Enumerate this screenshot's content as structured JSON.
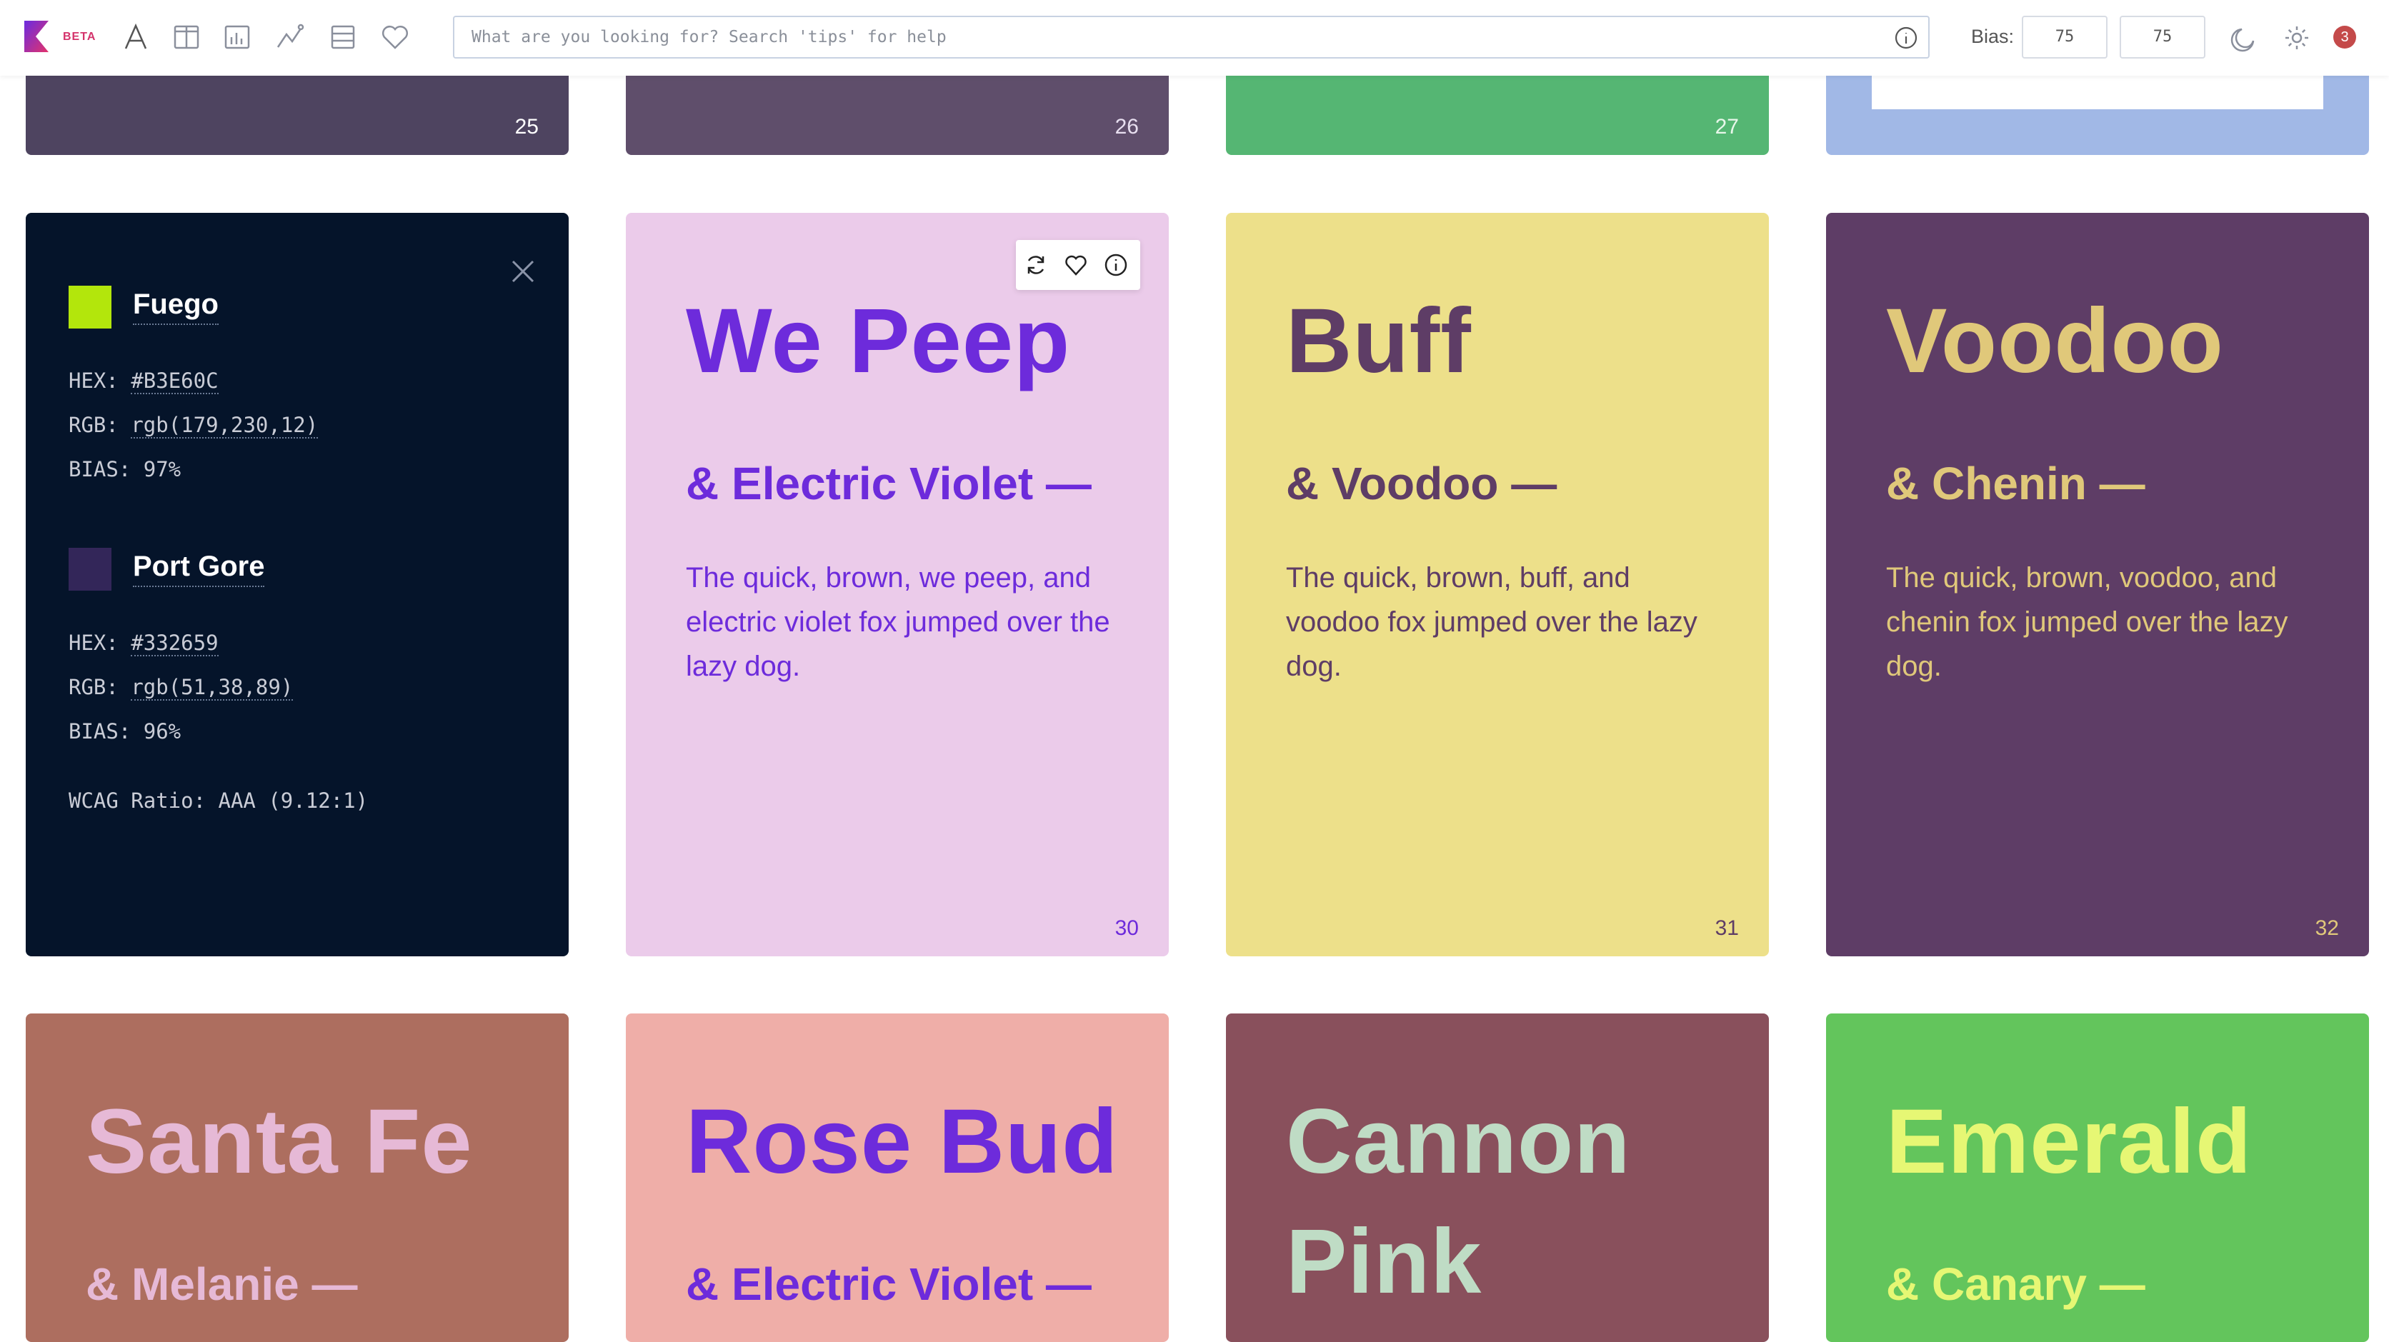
{
  "header": {
    "beta": "BETA",
    "search_placeholder": "What are you looking for? Search 'tips' for help",
    "bias_label": "Bias:",
    "bias_1": "75",
    "bias_2": "75",
    "notification_count": "3"
  },
  "row_top": [
    {
      "num": "25",
      "bg": "#4e4460",
      "color": "#ffffff"
    },
    {
      "num": "26",
      "bg": "#5f4e6b",
      "color": "#e8dff0"
    },
    {
      "num": "27",
      "bg": "#55b673",
      "color": "#e8f7ea"
    },
    {
      "num": "",
      "bg": "#a1b8e6",
      "color": "#ffffff"
    }
  ],
  "info_panel": {
    "color1": {
      "name": "Fuego",
      "hex_label": "HEX:",
      "hex": "#B3E60C",
      "rgb_label": "RGB:",
      "rgb": "rgb(179,230,12)",
      "bias": "BIAS: 97%",
      "swatch": "#B3E60C"
    },
    "color2": {
      "name": "Port Gore",
      "hex_label": "HEX:",
      "hex": "#332659",
      "rgb_label": "RGB:",
      "rgb": "rgb(51,38,89)",
      "bias": "BIAS: 96%",
      "swatch": "#332659"
    },
    "wcag": "WCAG Ratio: AAA (9.12:1)"
  },
  "cards": [
    {
      "title": "We Peep",
      "subtitle": "& Electric Violet —",
      "body": "The quick, brown, we peep, and electric violet fox jumped over the lazy dog.",
      "num": "30",
      "bg": "#ebcbea",
      "fg": "#6d2bdb"
    },
    {
      "title": "Buff",
      "subtitle": "& Voodoo —",
      "body": "The quick, brown, buff, and voodoo fox jumped over the lazy dog.",
      "num": "31",
      "bg": "#ede08a",
      "fg": "#5e3d66"
    },
    {
      "title": "Voodoo",
      "subtitle": "& Chenin —",
      "body": "The quick, brown, voodoo, and chenin fox jumped over the lazy dog.",
      "num": "32",
      "bg": "#5e3d66",
      "fg": "#e0c87a"
    }
  ],
  "row_bottom": [
    {
      "title": "Santa Fe",
      "subtitle": "& Melanie —",
      "bg": "#ad6e5f",
      "fg": "#e6b9d6"
    },
    {
      "title": "Rose Bud",
      "subtitle": "& Electric Violet —",
      "bg": "#efaea8",
      "fg": "#6d2bdb"
    },
    {
      "title": "Cannon Pink",
      "subtitle": "",
      "bg": "#89505c",
      "fg": "#bfdcc5"
    },
    {
      "title": "Emerald",
      "subtitle": "& Canary —",
      "bg": "#63c55c",
      "fg": "#e6f774"
    }
  ]
}
